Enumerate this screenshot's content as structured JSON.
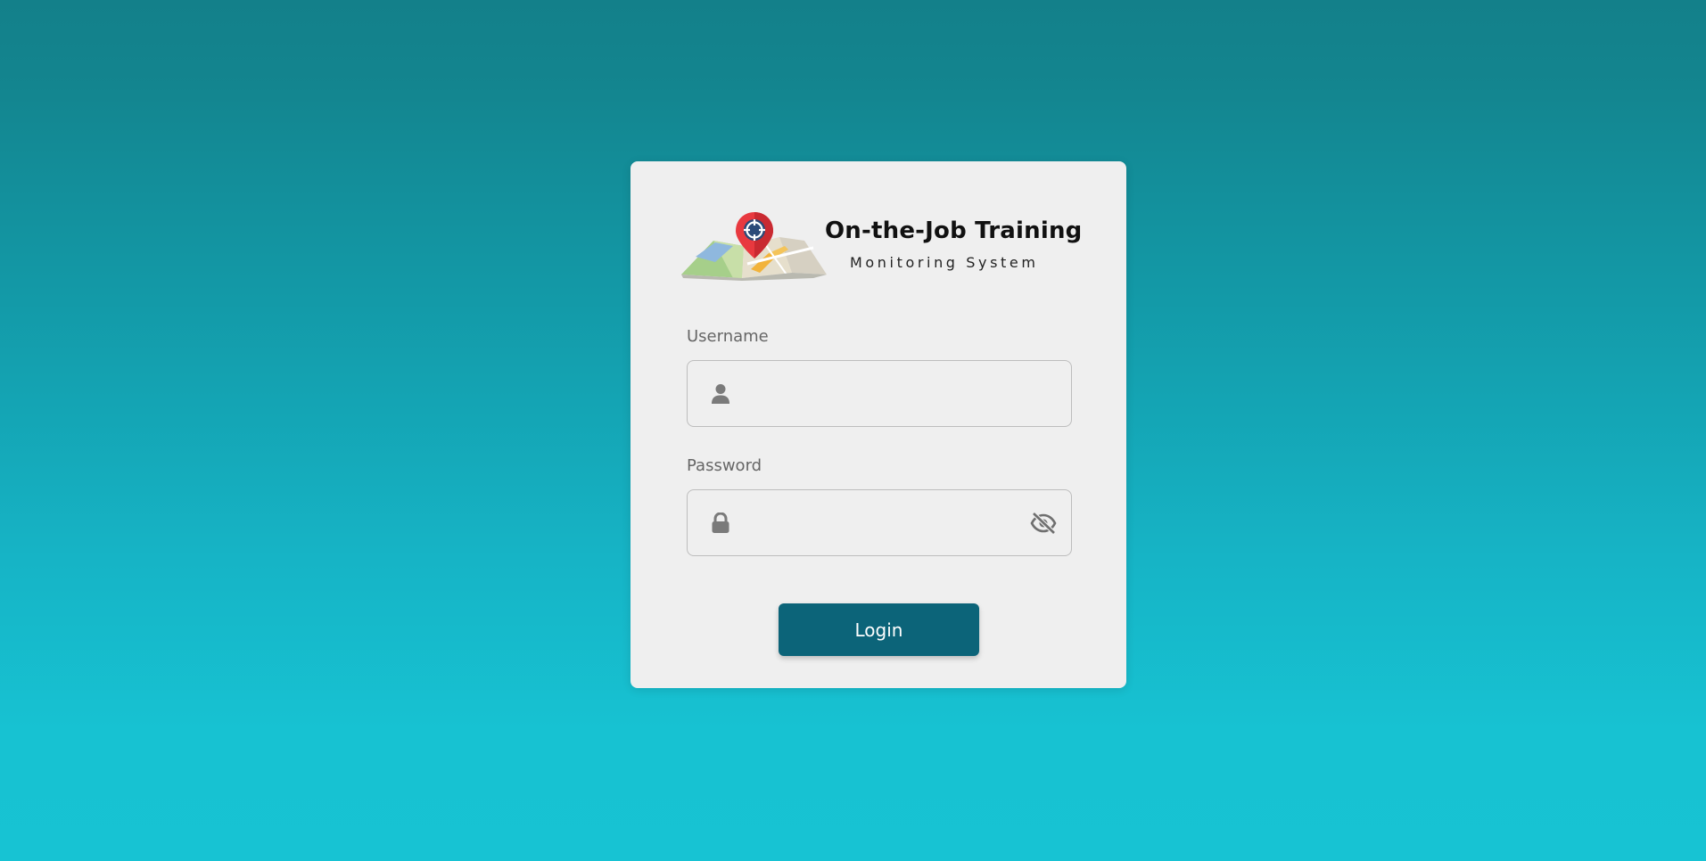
{
  "logo": {
    "title": "On-the-Job Training",
    "subtitle": "Monitoring System",
    "icon": "map-pin-icon"
  },
  "form": {
    "username_label": "Username",
    "username_value": "",
    "username_icon": "user-icon",
    "password_label": "Password",
    "password_value": "",
    "password_icon": "lock-icon",
    "visibility_icon": "eye-slash-icon",
    "login_label": "Login"
  },
  "colors": {
    "background_top": "#13808a",
    "background_bottom": "#17c3d3",
    "card": "#efefef",
    "button": "#0c6479",
    "icon": "#7a7a7a"
  }
}
